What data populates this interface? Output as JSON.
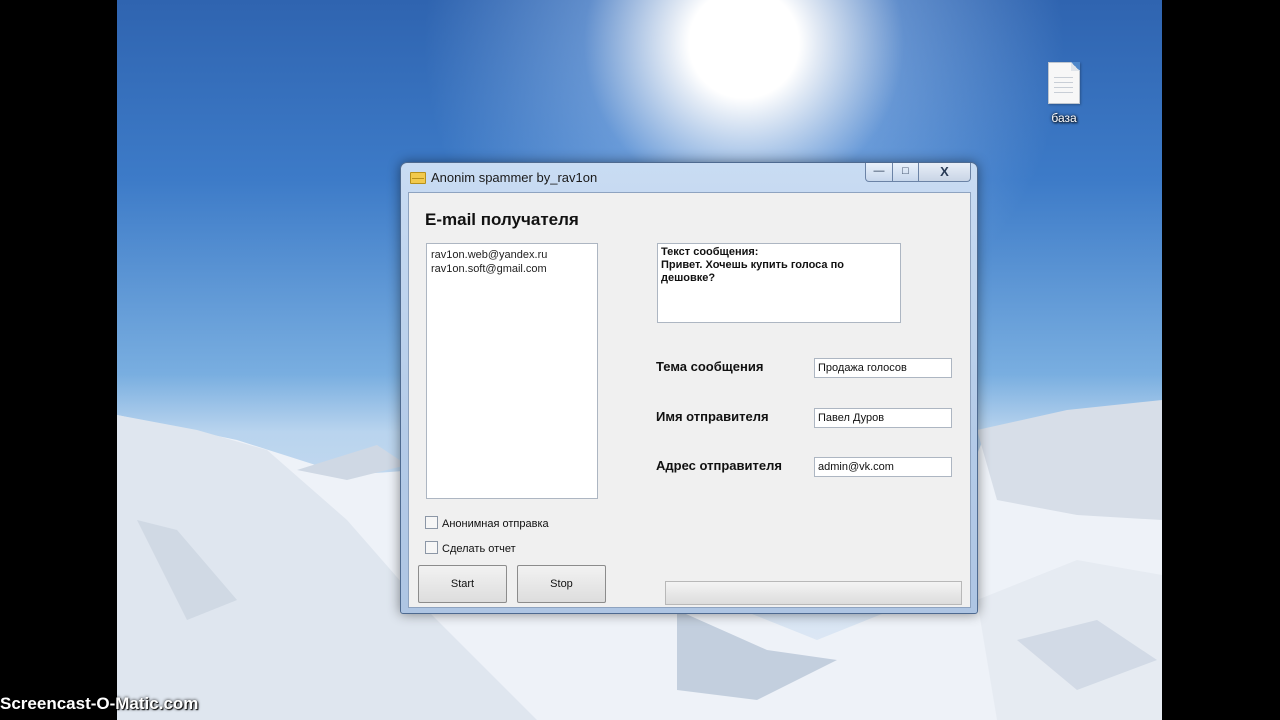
{
  "desktop": {
    "icon_label": "база"
  },
  "window": {
    "title": "Anonim spammer by_rav1on",
    "controls": {
      "minimize": "—",
      "maximize": "□",
      "close": "X"
    },
    "heading": "E-mail получателя",
    "recipients": [
      "rav1on.web@yandex.ru",
      "rav1on.soft@gmail.com"
    ],
    "message": {
      "label": "Текст сообщения:",
      "body": "Привет. Хочешь купить голоса по дешовке?"
    },
    "subject": {
      "label": "Тема сообщения",
      "value": "Продажа голосов"
    },
    "sender_name": {
      "label": "Имя отправителя",
      "value": "Павел Дуров"
    },
    "sender_address": {
      "label": "Адрес отправителя",
      "value": "admin@vk.com"
    },
    "checkboxes": {
      "anonymous": "Анонимная отправка",
      "report": "Сделать отчет"
    },
    "buttons": {
      "start": "Start",
      "stop": "Stop"
    },
    "progress": 0
  },
  "watermark": "Screencast-O-Matic.com"
}
